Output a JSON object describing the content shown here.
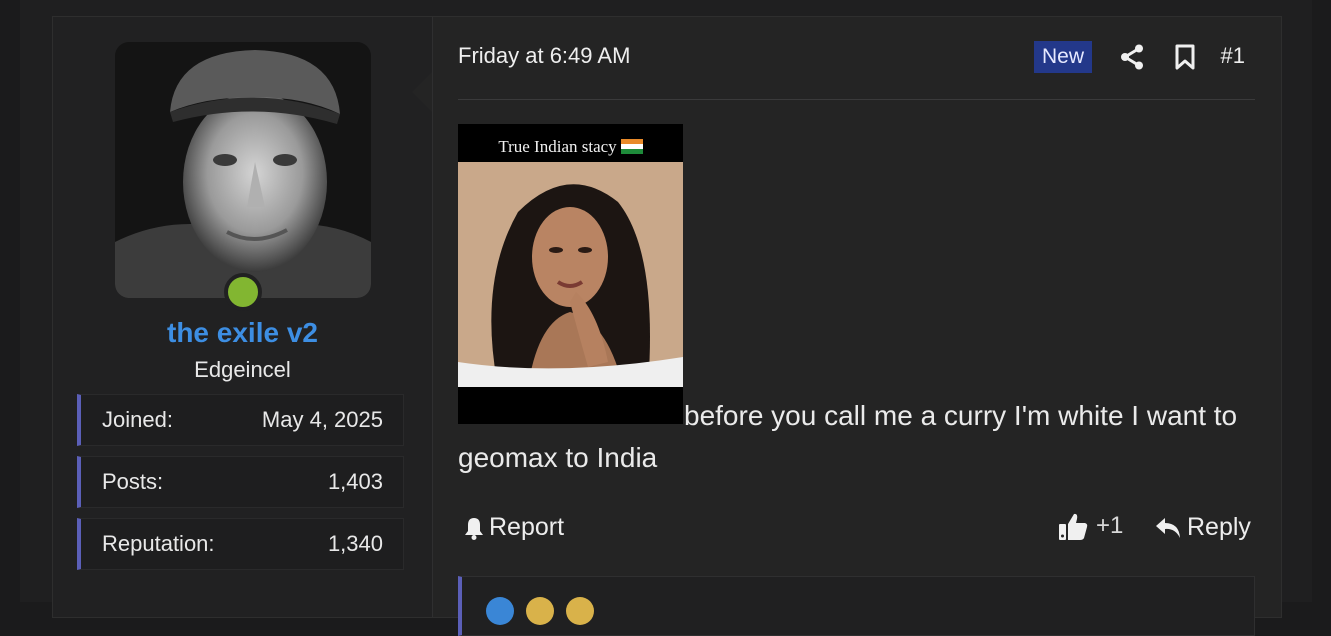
{
  "user": {
    "name": "the exile v2",
    "title": "Edgeincel",
    "online": true,
    "stats": [
      {
        "label": "Joined:",
        "value": "May 4, 2025"
      },
      {
        "label": "Posts:",
        "value": "1,403"
      },
      {
        "label": "Reputation:",
        "value": "1,340"
      }
    ]
  },
  "post": {
    "date": "Friday at 6:49 AM",
    "badge": "New",
    "number": "#1",
    "image_caption": "True Indian stacy",
    "text": "before you call me a curry I'm white I want to geomax to India"
  },
  "actions": {
    "report": "Report",
    "like_count": "+1",
    "reply": "Reply"
  },
  "icons": [
    "share-icon",
    "bookmark-icon",
    "bell-icon",
    "thumbs-up-icon",
    "reply-icon"
  ],
  "colors": {
    "username": "#3d8ee3",
    "online": "#82b631",
    "badge_bg": "#23388a",
    "stat_accent": "#5b5fb8"
  }
}
